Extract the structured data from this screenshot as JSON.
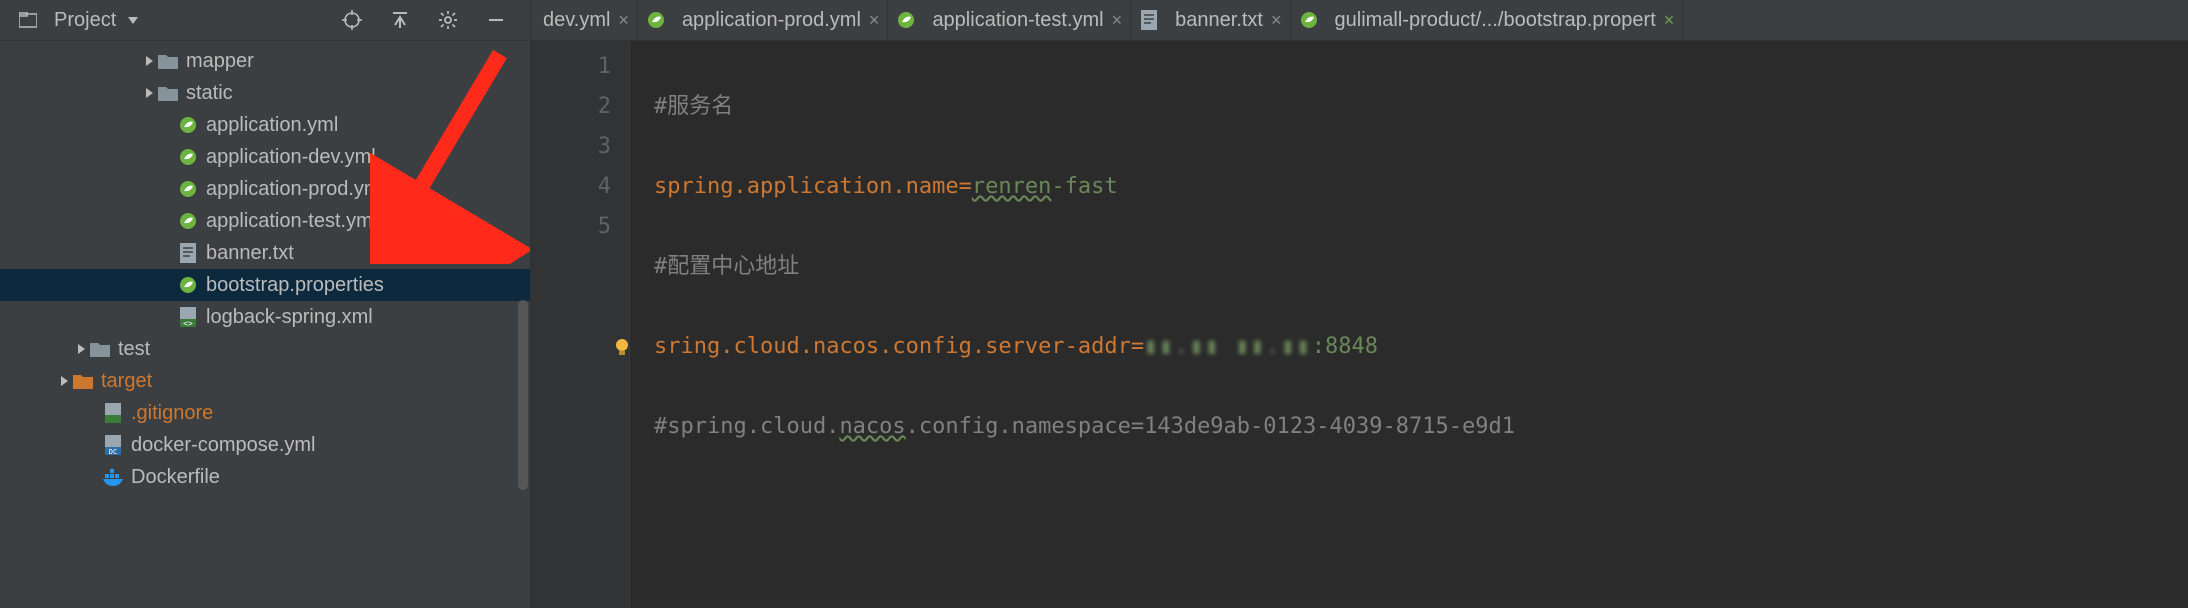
{
  "sidebar": {
    "title": "Project",
    "tree": [
      {
        "indent": 140,
        "arrow": "right",
        "icon": "folder",
        "label": "mapper"
      },
      {
        "indent": 140,
        "arrow": "right",
        "icon": "folder",
        "label": "static"
      },
      {
        "indent": 160,
        "arrow": "",
        "icon": "spring",
        "label": "application.yml"
      },
      {
        "indent": 160,
        "arrow": "",
        "icon": "spring",
        "label": "application-dev.yml"
      },
      {
        "indent": 160,
        "arrow": "",
        "icon": "spring",
        "label": "application-prod.yml"
      },
      {
        "indent": 160,
        "arrow": "",
        "icon": "spring",
        "label": "application-test.yml"
      },
      {
        "indent": 160,
        "arrow": "",
        "icon": "text",
        "label": "banner.txt"
      },
      {
        "indent": 160,
        "arrow": "",
        "icon": "spring",
        "label": "bootstrap.properties",
        "selected": true
      },
      {
        "indent": 160,
        "arrow": "",
        "icon": "xml",
        "label": "logback-spring.xml"
      },
      {
        "indent": 72,
        "arrow": "right",
        "icon": "folder",
        "label": "test"
      },
      {
        "indent": 55,
        "arrow": "right",
        "icon": "folder-orange",
        "label": "target",
        "cls": "target"
      },
      {
        "indent": 85,
        "arrow": "",
        "icon": "git",
        "label": ".gitignore",
        "cls": "orange"
      },
      {
        "indent": 85,
        "arrow": "",
        "icon": "yml-dc",
        "label": "docker-compose.yml"
      },
      {
        "indent": 85,
        "arrow": "",
        "icon": "docker",
        "label": "Dockerfile"
      }
    ]
  },
  "tabs": [
    {
      "icon": "none",
      "label": "dev.yml",
      "close": "plain"
    },
    {
      "icon": "spring",
      "label": "application-prod.yml",
      "close": "plain"
    },
    {
      "icon": "spring",
      "label": "application-test.yml",
      "close": "plain"
    },
    {
      "icon": "text",
      "label": "banner.txt",
      "close": "plain"
    },
    {
      "icon": "spring",
      "label": "gulimall-product/.../bootstrap.propert",
      "close": "green",
      "active": false
    }
  ],
  "code": {
    "line_numbers": [
      "1",
      "2",
      "3",
      "4",
      "5"
    ],
    "lines": {
      "l1_comment": "#服务名",
      "l2_key": "spring.application.name",
      "l2_eq": "=",
      "l2_val_underline": "renren",
      "l2_val_rest": "-fast",
      "l3_comment": "#配置中心地址",
      "l4_key_pre": "s",
      "l4_key_post": "ring.cloud.nacos.config.server-addr",
      "l4_eq": "=",
      "l4_val_pix": "▮▮.▮▮ ▮▮.▮▮",
      "l4_val_port": ":8848",
      "l5_comment_pre": "#spring.cloud.",
      "l5_comment_mid": "nacos",
      "l5_comment_post": ".config.namespace=143de9ab-0123-4039-8715-e9d1"
    }
  }
}
